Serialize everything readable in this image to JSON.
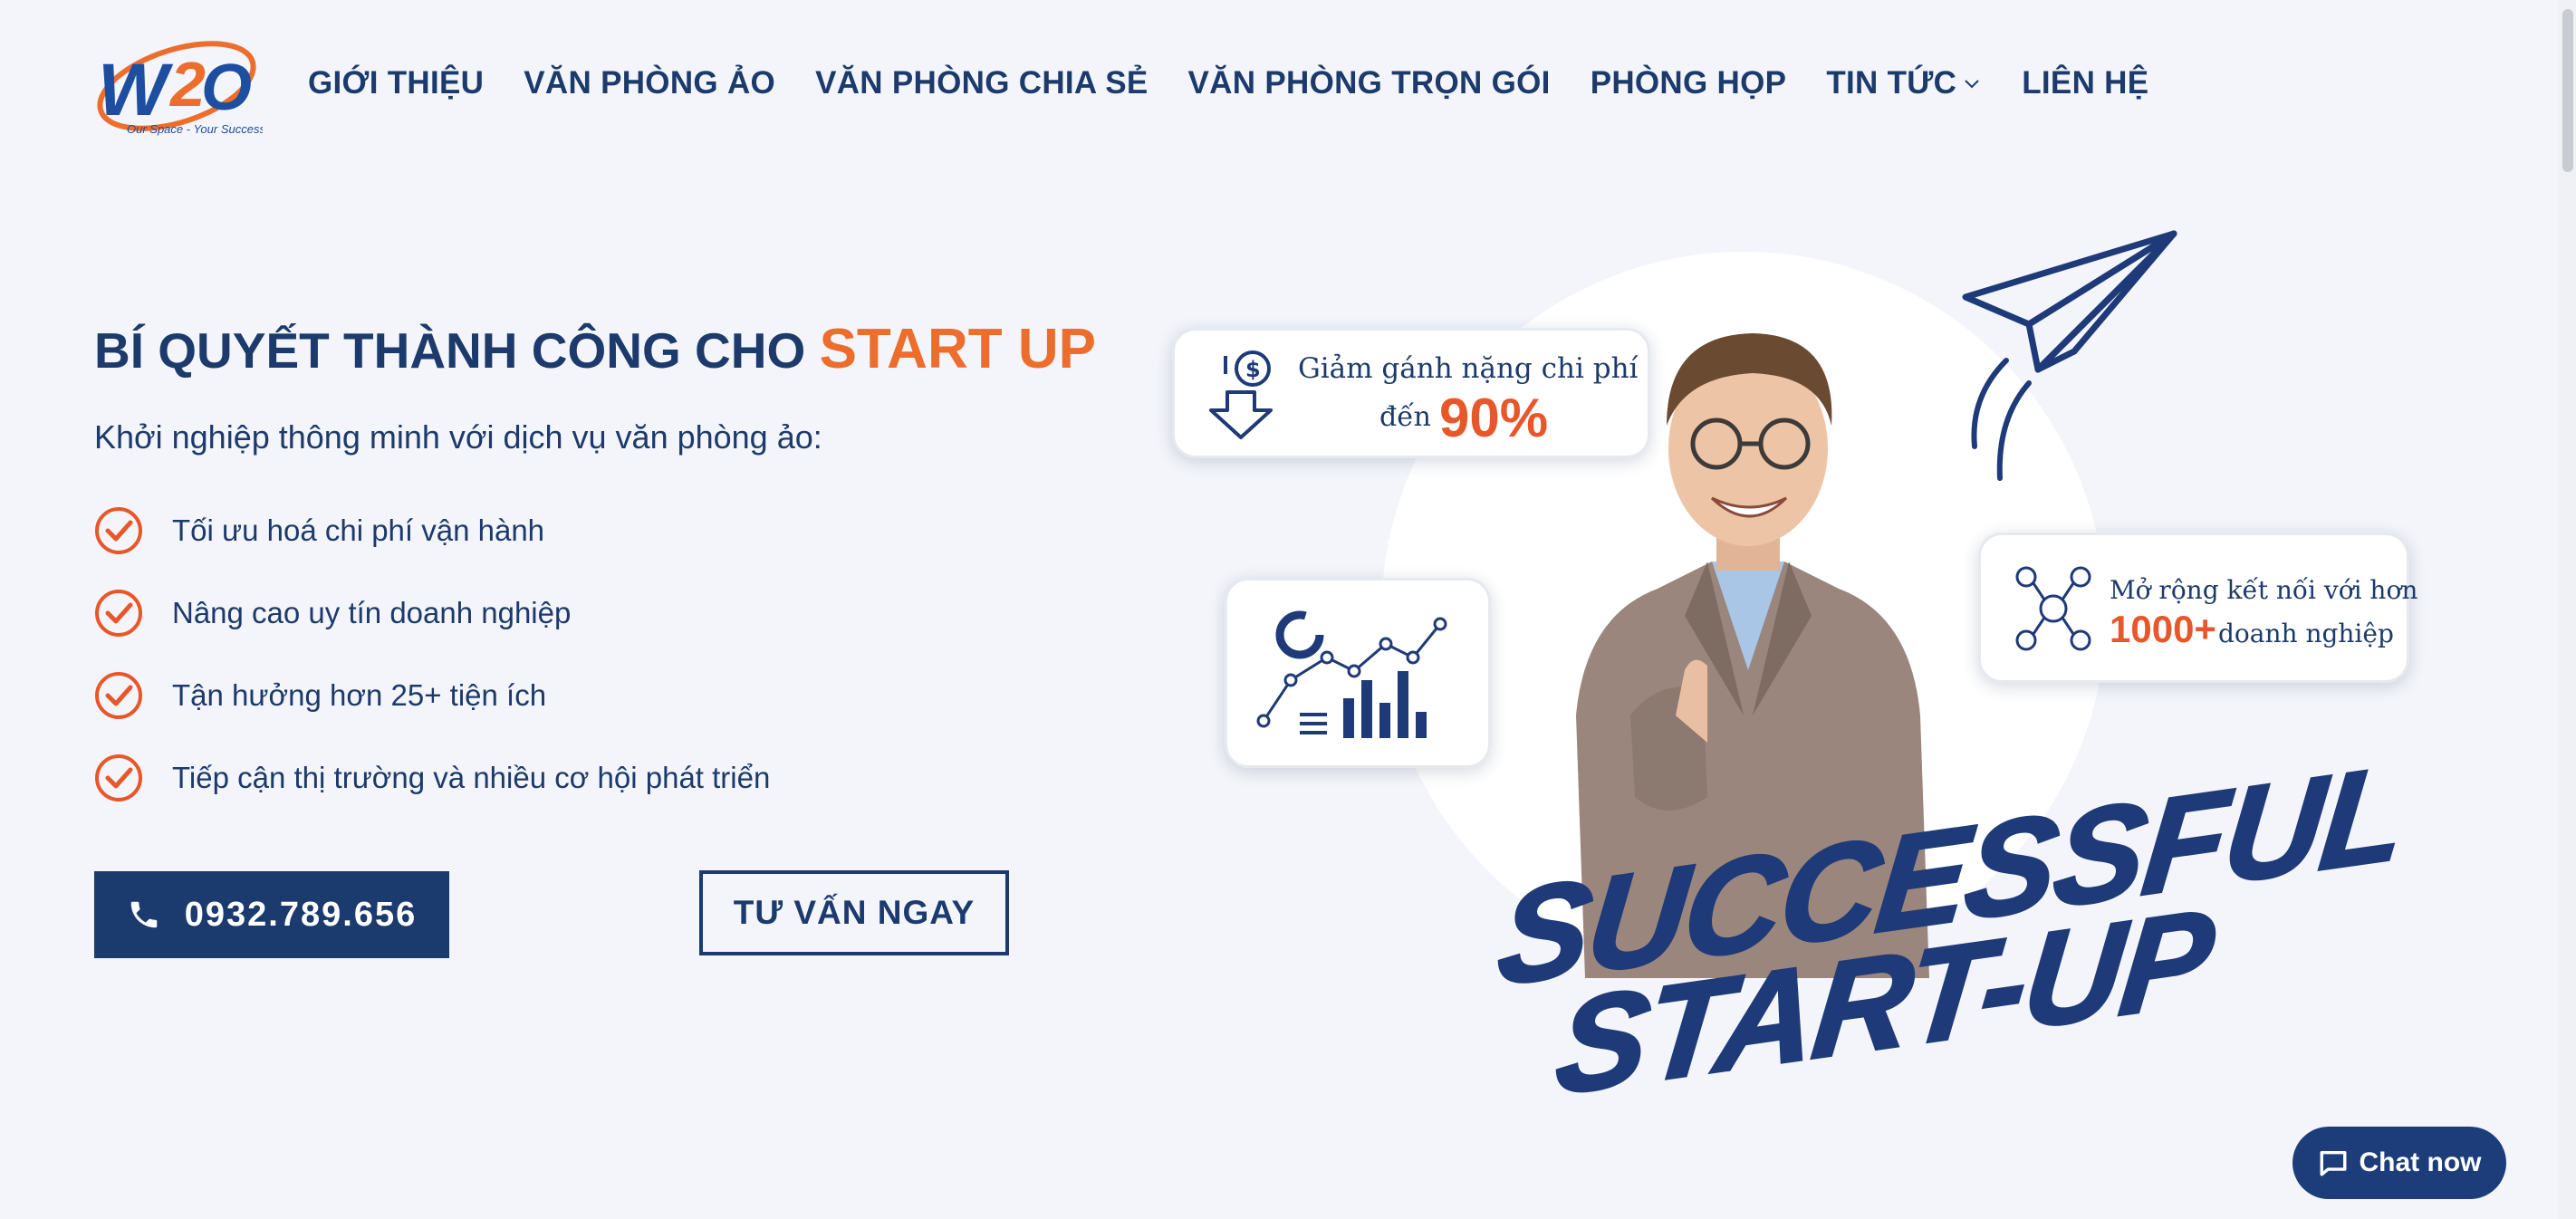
{
  "header": {
    "logo_text": "W2O",
    "logo_tagline": "Our Space - Your Success",
    "nav": [
      {
        "label": "GIỚI THIỆU"
      },
      {
        "label": "VĂN PHÒNG ẢO"
      },
      {
        "label": "VĂN PHÒNG CHIA SẺ"
      },
      {
        "label": "VĂN PHÒNG TRỌN GÓI"
      },
      {
        "label": "PHÒNG HỌP"
      },
      {
        "label": "TIN TỨC",
        "has_dropdown": true,
        "icon": "chevron-down-icon"
      },
      {
        "label": "LIÊN HỆ"
      }
    ]
  },
  "hero": {
    "title_main": "BÍ QUYẾT THÀNH CÔNG CHO",
    "title_accent": "START UP",
    "subtitle": "Khởi nghiệp thông minh với dịch vụ văn phòng ảo:",
    "benefits": [
      "Tối ưu hoá chi phí vận hành",
      "Nâng cao uy tín doanh nghiệp",
      "Tận hưởng hơn 25+ tiện ích",
      "Tiếp cận thị trường và nhiều cơ hội phát triển"
    ],
    "phone_button": "0932.789.656",
    "consult_button": "TƯ VẤN NGAY"
  },
  "art": {
    "cost_card_line1": "Giảm gánh nặng chi phí",
    "cost_card_line2": "đến",
    "cost_card_percent": "90%",
    "network_card_line1": "Mở rộng kết nối với hơn",
    "network_card_number": "1000+",
    "network_card_line2": "doanh nghiệp",
    "headline_1": "SUCCESSFUL",
    "headline_2": "START-UP"
  },
  "chat": {
    "label": "Chat now"
  },
  "colors": {
    "navy": "#1b3a6e",
    "orange": "#ec6d2c",
    "background": "#f3f5fa"
  }
}
